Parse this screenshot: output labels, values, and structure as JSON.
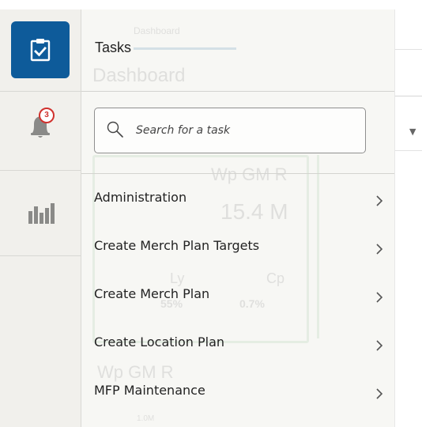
{
  "rail": {
    "notification_count": "3"
  },
  "panel": {
    "title": "Tasks",
    "search": {
      "placeholder": "Search for a task"
    },
    "items": [
      {
        "label": "Administration"
      },
      {
        "label": "Create Merch Plan Targets"
      },
      {
        "label": "Create Merch Plan"
      },
      {
        "label": "Create Location Plan"
      },
      {
        "label": "MFP Maintenance"
      }
    ]
  },
  "background": {
    "breadcrumb": "Dashboard",
    "heading": "Dashboard",
    "tile": {
      "title": "Wp GM R",
      "value": "15.4 M",
      "col1_label": "Ly",
      "col1_value": "55%",
      "col2_label": "Cp",
      "col2_value": "0.7%"
    },
    "tile2_title": "Wp GM R",
    "axis_tick": "1.0M"
  },
  "colors": {
    "accent": "#0e5b9a",
    "badge": "#d0312d",
    "rail_bg": "#f1f0ec"
  }
}
